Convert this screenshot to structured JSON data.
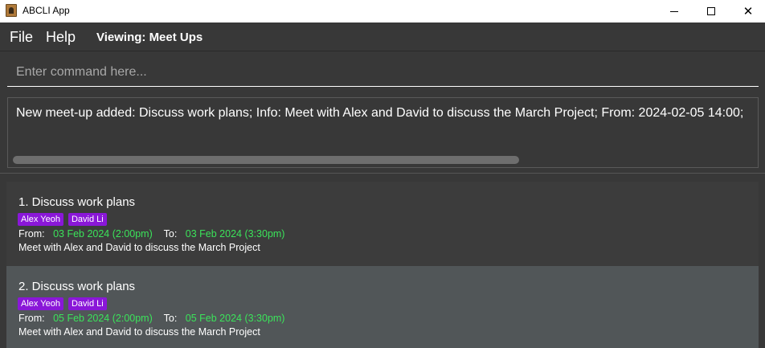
{
  "window": {
    "title": "ABCLI App",
    "icon": "app-icon",
    "controls": {
      "minimize": "minimize-icon",
      "maximize": "maximize-icon",
      "close": "✕"
    }
  },
  "menu": {
    "items": [
      "File",
      "Help"
    ],
    "viewing": "Viewing: Meet Ups"
  },
  "command": {
    "placeholder": "Enter command here...",
    "value": ""
  },
  "result": {
    "text": "New meet-up added: Discuss work plans; Info: Meet with Alex and David to discuss the March Project; From: 2024-02-05 14:00;"
  },
  "meetups": [
    {
      "title": "1. Discuss work plans",
      "tags": [
        "Alex Yeoh",
        "David Li"
      ],
      "from_label": "From:",
      "from": "03 Feb 2024 (2:00pm)",
      "to_label": "To:",
      "to": "03 Feb 2024 (3:30pm)",
      "info": "Meet with Alex and David to discuss the March Project"
    },
    {
      "title": "2. Discuss work plans",
      "tags": [
        "Alex Yeoh",
        "David Li"
      ],
      "from_label": "From:",
      "from": "05 Feb 2024 (2:00pm)",
      "to_label": "To:",
      "to": "05 Feb 2024 (3:30pm)",
      "info": "Meet with Alex and David to discuss the March Project"
    }
  ],
  "colors": {
    "background": "#383838",
    "tag": "#8a17d8",
    "datetime": "#3be35a",
    "selected_card": "#515658"
  }
}
